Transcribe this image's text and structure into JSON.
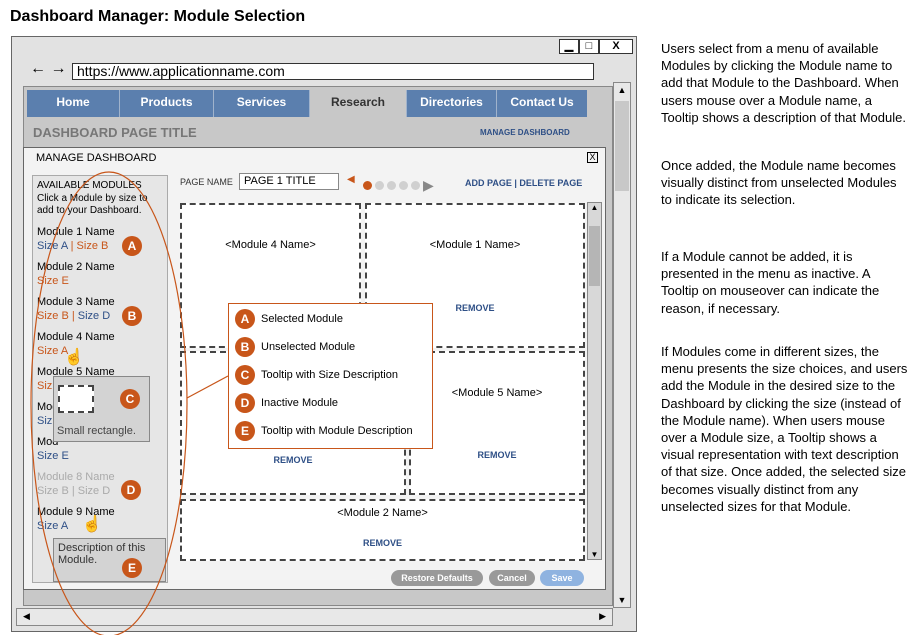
{
  "page_title": "Dashboard Manager: Module Selection",
  "window_controls": {
    "minimize": "▁",
    "maximize": "□",
    "close": "X"
  },
  "browser": {
    "url": "https://www.applicationname.com",
    "back": "←",
    "forward": "→"
  },
  "nav": {
    "tabs": [
      "Home",
      "Products",
      "Services",
      "Research",
      "Directories",
      "Contact Us"
    ],
    "active": "Research"
  },
  "dashboard": {
    "title": "DASHBOARD PAGE TITLE",
    "manage_link": "MANAGE DASHBOARD"
  },
  "modal": {
    "title": "MANAGE DASHBOARD",
    "close": "X",
    "sidebar": {
      "heading": "AVAILABLE MODULES",
      "instructions": "Click a Module by size to add to your Dashboard.",
      "modules": [
        {
          "name": "Module 1 Name",
          "sizes": "Size A | Size B"
        },
        {
          "name": "Module 2 Name",
          "sizes": "Size E"
        },
        {
          "name": "Module 3 Name",
          "sizes": "Size B | Size D"
        },
        {
          "name": "Module 4 Name",
          "sizes": "Size A"
        },
        {
          "name": "Module 5 Name",
          "sizes": "Siz"
        },
        {
          "name": "Mod",
          "sizes": "Siz"
        },
        {
          "name": "Mod",
          "sizes": "Size E"
        },
        {
          "name": "Module 8 Name",
          "sizes": "Size B | Size D"
        },
        {
          "name": "Module 9 Name",
          "sizes": "Size A"
        }
      ]
    },
    "page_name_label": "PAGE NAME",
    "page_name_value": "PAGE 1 TITLE",
    "page_links": "ADD PAGE | DELETE PAGE",
    "modules_grid": [
      {
        "label": "<Module 4 Name>"
      },
      {
        "label": "<Module 1 Name>",
        "remove": "REMOVE"
      },
      {
        "label": "",
        "remove": "REMOVE"
      },
      {
        "label": "<Module 5 Name>",
        "remove": "REMOVE"
      },
      {
        "label": "<Module 2 Name>",
        "remove": "REMOVE"
      }
    ],
    "buttons": {
      "restore": "Restore Defaults",
      "cancel": "Cancel",
      "save": "Save"
    }
  },
  "tooltip_size": {
    "text": "Small rectangle."
  },
  "tooltip_desc": {
    "text": "Description of this Module."
  },
  "legend": [
    {
      "key": "A",
      "label": "Selected Module"
    },
    {
      "key": "B",
      "label": "Unselected Module"
    },
    {
      "key": "C",
      "label": "Tooltip with Size Description"
    },
    {
      "key": "D",
      "label": "Inactive Module"
    },
    {
      "key": "E",
      "label": "Tooltip with Module Description"
    }
  ],
  "description": [
    "Users select from a menu of available Modules by clicking the Module name to add that Module to the Dashboard. When users mouse over a Module name, a Tooltip shows a description of that Module.",
    "Once added, the Module name becomes visually distinct from unselected Modules to indicate its selection.",
    "If a Module cannot be added, it is presented in the menu as inactive. A Tooltip on mouseover can indicate the reason, if necessary.",
    "If Modules come in different sizes, the menu presents the size choices, and users add the Module in the desired size to the Dashboard by clicking the size (instead of the Module name). When users mouse over a Module size, a Tooltip shows a visual representation with text description of that size. Once added, the selected size becomes visually distinct from any unselected sizes for that Module."
  ],
  "colors": {
    "accent": "#c8561a",
    "nav": "#5b7fae",
    "link": "#2e4f86"
  }
}
